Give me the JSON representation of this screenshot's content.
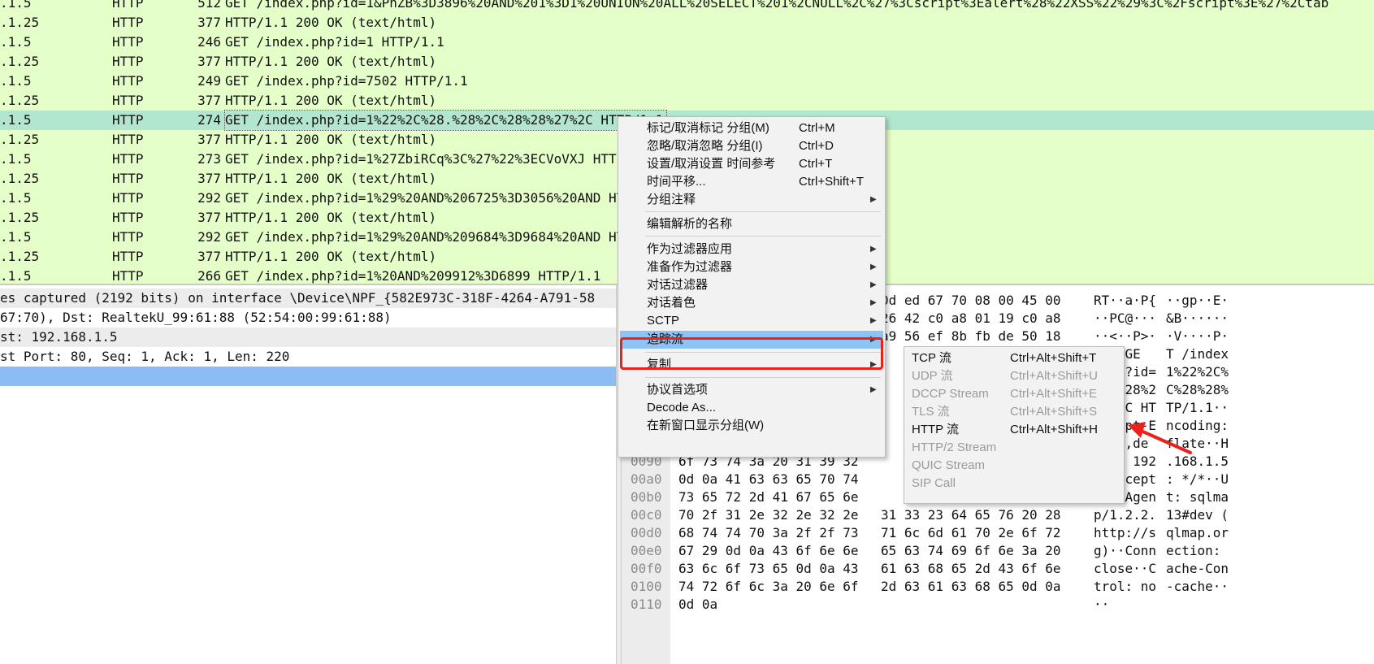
{
  "packet_list": {
    "rows": [
      {
        "src": ".1.5",
        "proto": "HTTP",
        "len": "512",
        "info": "GET /index.php?id=1&PhZB%3D3896%20AND%201%3D1%20UNION%20ALL%20SELECT%201%2CNULL%2C%27%3Cscript%3Ealert%28%22XSS%22%29%3C%2Fscript%3E%27%2Ctab"
      },
      {
        "src": ".1.25",
        "proto": "HTTP",
        "len": "377",
        "info": "HTTP/1.1 200 OK  (text/html)"
      },
      {
        "src": ".1.5",
        "proto": "HTTP",
        "len": "246",
        "info": "GET /index.php?id=1 HTTP/1.1"
      },
      {
        "src": ".1.25",
        "proto": "HTTP",
        "len": "377",
        "info": "HTTP/1.1 200 OK  (text/html)"
      },
      {
        "src": ".1.5",
        "proto": "HTTP",
        "len": "249",
        "info": "GET /index.php?id=7502 HTTP/1.1"
      },
      {
        "src": ".1.25",
        "proto": "HTTP",
        "len": "377",
        "info": "HTTP/1.1 200 OK  (text/html)"
      },
      {
        "src": ".1.5",
        "proto": "HTTP",
        "len": "274",
        "info": "GET /index.php?id=1%22%2C%28.%28%2C%28%28%27%2C HTTP/1.1",
        "selected": true
      },
      {
        "src": ".1.25",
        "proto": "HTTP",
        "len": "377",
        "info": "HTTP/1.1 200 OK  (text/html)"
      },
      {
        "src": ".1.5",
        "proto": "HTTP",
        "len": "273",
        "info": "GET /index.php?id=1%27ZbiRCq%3C%27%22%3ECVoVXJ HTTP/1.1"
      },
      {
        "src": ".1.25",
        "proto": "HTTP",
        "len": "377",
        "info": "HTTP/1.1 200 OK  (text/html)"
      },
      {
        "src": ".1.5",
        "proto": "HTTP",
        "len": "292",
        "info": "GET /index.php?id=1%29%20AND%206725%3D3056%20AND HTTP/1.1"
      },
      {
        "src": ".1.25",
        "proto": "HTTP",
        "len": "377",
        "info": "HTTP/1.1 200 OK  (text/html)"
      },
      {
        "src": ".1.5",
        "proto": "HTTP",
        "len": "292",
        "info": "GET /index.php?id=1%29%20AND%209684%3D9684%20AND HTTP/1.1"
      },
      {
        "src": ".1.25",
        "proto": "HTTP",
        "len": "377",
        "info": "HTTP/1.1 200 OK  (text/html)"
      },
      {
        "src": ".1.5",
        "proto": "HTTP",
        "len": "266",
        "info": "GET /index.php?id=1%20AND%209912%3D6899 HTTP/1.1"
      }
    ]
  },
  "details": {
    "lines": [
      "es captured (2192 bits) on interface \\Device\\NPF_{582E973C-318F-4264-A791-58",
      "67:70), Dst: RealtekU_99:61:88 (52:54:00:99:61:88)",
      "st: 192.168.1.5",
      "st Port: 80, Seq: 1, Ack: 1, Len: 220",
      ""
    ]
  },
  "bytes": {
    "lines": [
      {
        "off": "",
        "hex1": "",
        "hex2": "0d ed 67 70 08 00 45 00",
        "asc1": "RT··a·P{",
        "asc2": "··gp··E·"
      },
      {
        "off": "",
        "hex1": "",
        "hex2": "26 42 c0 a8 01 19 c0 a8",
        "asc1": "··PC@···",
        "asc2": "&B······"
      },
      {
        "off": "",
        "hex1": "",
        "hex2": "a9 56 ef 8b fb de 50 18",
        "asc1": "··<··P>·",
        "asc2": "·V····P·"
      },
      {
        "off": "",
        "hex1": "",
        "hex2": "",
        "asc1": "····GE",
        "asc2": "T /index"
      },
      {
        "off": "",
        "hex1": "",
        "hex2": "",
        "asc1": ".php?id=",
        "asc2": "1%22%2C%"
      },
      {
        "off": "",
        "hex1": "",
        "hex2": "",
        "asc1": "28.%28%2",
        "asc2": "C%28%28%"
      },
      {
        "off": "",
        "hex1": "",
        "hex2": "",
        "asc1": "27%2C HT",
        "asc2": "TP/1.1··"
      },
      {
        "off": "",
        "hex1": "",
        "hex2": "",
        "asc1": "Accept-E",
        "asc2": "ncoding:"
      },
      {
        "off": "",
        "hex1": "",
        "hex2": "",
        "asc1": " gzip,de",
        "asc2": "flate··H"
      },
      {
        "off": "0090",
        "hex1": "6f 73 74 3a 20 31 39 32",
        "hex2": "",
        "asc1": "ost: 192",
        "asc2": ".168.1.5"
      },
      {
        "off": "00a0",
        "hex1": "0d 0a 41 63 63 65 70 74",
        "hex2": "",
        "asc1": "··Accept",
        "asc2": ": */*··U"
      },
      {
        "off": "00b0",
        "hex1": "73 65 72 2d 41 67 65 6e",
        "hex2": "",
        "asc1": "ser-Agen",
        "asc2": "t: sqlma"
      },
      {
        "off": "00c0",
        "hex1": "70 2f 31 2e 32 2e 32 2e",
        "hex2": "31 33 23 64 65 76 20 28",
        "asc1": "p/1.2.2.",
        "asc2": "13#dev ("
      },
      {
        "off": "00d0",
        "hex1": "68 74 74 70 3a 2f 2f 73",
        "hex2": "71 6c 6d 61 70 2e 6f 72",
        "asc1": "http://s",
        "asc2": "qlmap.or"
      },
      {
        "off": "00e0",
        "hex1": "67 29 0d 0a 43 6f 6e 6e",
        "hex2": "65 63 74 69 6f 6e 3a 20",
        "asc1": "g)··Conn",
        "asc2": "ection: "
      },
      {
        "off": "00f0",
        "hex1": "63 6c 6f 73 65 0d 0a 43",
        "hex2": "61 63 68 65 2d 43 6f 6e",
        "asc1": "close··C",
        "asc2": "ache-Con"
      },
      {
        "off": "0100",
        "hex1": "74 72 6f 6c 3a 20 6e 6f",
        "hex2": "2d 63 61 63 68 65 0d 0a",
        "asc1": "trol: no",
        "asc2": "-cache··"
      },
      {
        "off": "0110",
        "hex1": "0d 0a",
        "hex2": "",
        "asc1": "··",
        "asc2": ""
      }
    ]
  },
  "context_menu": {
    "items": [
      {
        "label": "标记/取消标记 分组(M)",
        "shortcut": "Ctrl+M"
      },
      {
        "label": "忽略/取消忽略 分组(I)",
        "shortcut": "Ctrl+D"
      },
      {
        "label": "设置/取消设置 时间参考",
        "shortcut": "Ctrl+T"
      },
      {
        "label": "时间平移...",
        "shortcut": "Ctrl+Shift+T"
      },
      {
        "label": "分组注释",
        "shortcut": ""
      },
      {
        "label": "编辑解析的名称",
        "shortcut": ""
      },
      {
        "label": "作为过滤器应用",
        "shortcut": ""
      },
      {
        "label": "准备作为过滤器",
        "shortcut": ""
      },
      {
        "label": "对话过滤器",
        "shortcut": ""
      },
      {
        "label": "对话着色",
        "shortcut": ""
      },
      {
        "label": "SCTP",
        "shortcut": ""
      },
      {
        "label": "追踪流",
        "shortcut": ""
      },
      {
        "label": "复制",
        "shortcut": ""
      },
      {
        "label": "协议首选项",
        "shortcut": ""
      },
      {
        "label": "Decode As...",
        "shortcut": ""
      },
      {
        "label": "在新窗口显示分组(W)",
        "shortcut": ""
      }
    ]
  },
  "follow_submenu": {
    "items": [
      {
        "label": "TCP 流",
        "shortcut": "Ctrl+Alt+Shift+T",
        "enabled": true
      },
      {
        "label": "UDP 流",
        "shortcut": "Ctrl+Alt+Shift+U",
        "enabled": false
      },
      {
        "label": "DCCP Stream",
        "shortcut": "Ctrl+Alt+Shift+E",
        "enabled": false
      },
      {
        "label": "TLS 流",
        "shortcut": "Ctrl+Alt+Shift+S",
        "enabled": false
      },
      {
        "label": "HTTP 流",
        "shortcut": "Ctrl+Alt+Shift+H",
        "enabled": true
      },
      {
        "label": "HTTP/2 Stream",
        "shortcut": "",
        "enabled": false
      },
      {
        "label": "QUIC Stream",
        "shortcut": "",
        "enabled": false
      },
      {
        "label": "SIP Call",
        "shortcut": "",
        "enabled": false
      }
    ]
  },
  "icons": {
    "submenu_arrow": "chevron-right-icon",
    "annotation_arrow": "red-arrow-icon"
  },
  "colors": {
    "packet_bg": "#e4ffc7",
    "selected_row": "#b3e6cf",
    "menu_hover": "#8ec3f5",
    "annotation_red": "#e8231c"
  }
}
